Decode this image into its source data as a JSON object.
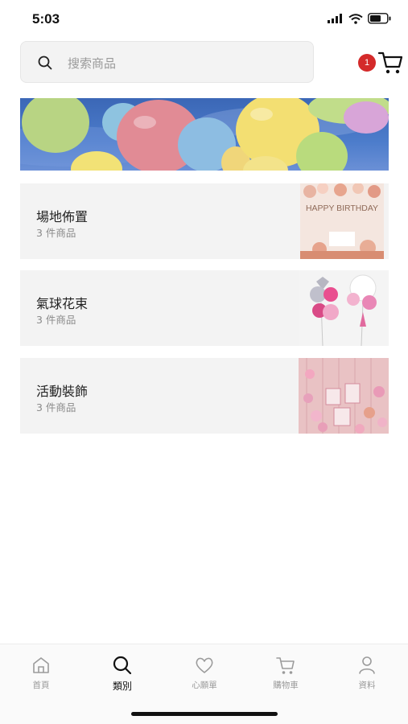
{
  "status_bar": {
    "time": "5:03"
  },
  "search": {
    "placeholder": "搜索商品"
  },
  "cart": {
    "badge_count": "1"
  },
  "categories": [
    {
      "title": "場地佈置",
      "count": "3 件商品",
      "thumb_text": "HAPPY BIRTHDAY"
    },
    {
      "title": "氣球花束",
      "count": "3 件商品"
    },
    {
      "title": "活動裝飾",
      "count": "3 件商品"
    }
  ],
  "tabbar": {
    "tabs": [
      {
        "label": "首頁",
        "icon": "home-icon",
        "active": false
      },
      {
        "label": "類別",
        "icon": "search-icon",
        "active": true
      },
      {
        "label": "心願單",
        "icon": "heart-icon",
        "active": false
      },
      {
        "label": "購物車",
        "icon": "cart-icon",
        "active": false
      },
      {
        "label": "資料",
        "icon": "user-icon",
        "active": false
      }
    ]
  },
  "colors": {
    "badge": "#d42a2a",
    "card_bg": "#f3f3f3",
    "banner_sky": "#3b67b6"
  }
}
